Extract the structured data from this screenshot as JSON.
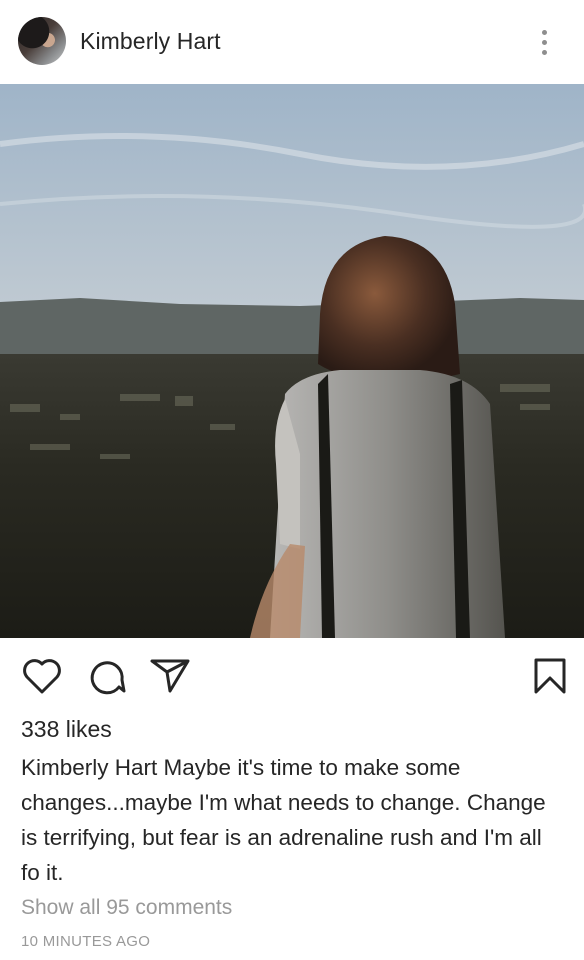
{
  "post": {
    "username": "Kimberly Hart",
    "likes_text": "338 likes",
    "caption_user": "Kimberly Hart",
    "caption_text": " Maybe it's time to make some changes...maybe I'm what needs to change. Change is terrifying, but fear is an adrenaline rush and I'm all fo it.",
    "comments_link": "Show all 95 comments",
    "timestamp": "10 MINUTES AGO"
  },
  "icons": {
    "menu": "more-vertical-icon",
    "like": "heart-icon",
    "comment": "comment-icon",
    "share": "send-icon",
    "save": "bookmark-icon"
  },
  "colors": {
    "text_primary": "#262626",
    "text_secondary": "#999999",
    "background": "#ffffff"
  }
}
